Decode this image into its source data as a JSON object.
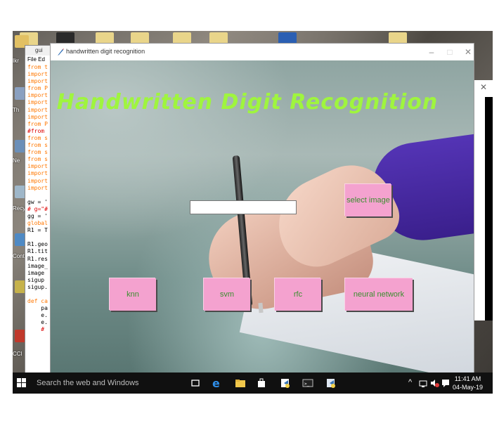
{
  "app_window": {
    "title": "handwritten digit recognition",
    "heading": "Handwritten Digit Recognition",
    "path_input_value": "",
    "buttons": {
      "select_image": "select image",
      "knn": "knn",
      "svm": "svm",
      "rfc": "rfc",
      "neural_network": "neural network"
    },
    "controls": {
      "minimize": "–",
      "maximize": "□",
      "close": "✕"
    },
    "colors": {
      "heading": "#9ff53e",
      "button_bg": "#f4a2cf",
      "button_text": "#3a8f2f"
    }
  },
  "editor_window": {
    "title": "gui",
    "menu": "File  Ed",
    "code_lines": [
      {
        "text": "from t",
        "style": "kw"
      },
      {
        "text": "import",
        "style": "kw"
      },
      {
        "text": "import",
        "style": "kw"
      },
      {
        "text": "from P",
        "style": "kw"
      },
      {
        "text": "import",
        "style": "kw"
      },
      {
        "text": "import",
        "style": "kw"
      },
      {
        "text": "import",
        "style": "kw"
      },
      {
        "text": "import",
        "style": "kw"
      },
      {
        "text": "from P",
        "style": "kw"
      },
      {
        "text": "#from ",
        "style": "cm"
      },
      {
        "text": "from s",
        "style": "kw"
      },
      {
        "text": "from s",
        "style": "kw"
      },
      {
        "text": "from s",
        "style": "kw"
      },
      {
        "text": "from s",
        "style": "kw"
      },
      {
        "text": "import",
        "style": "kw"
      },
      {
        "text": "import",
        "style": "kw"
      },
      {
        "text": "import",
        "style": "kw"
      },
      {
        "text": "import",
        "style": "kw"
      },
      {
        "text": "",
        "style": "pl"
      },
      {
        "text": "gw = '",
        "style": "pl"
      },
      {
        "text": "# g=\"#",
        "style": "cm"
      },
      {
        "text": "gg = '",
        "style": "pl"
      },
      {
        "text": "global",
        "style": "kw"
      },
      {
        "text": "R1 = T",
        "style": "pl"
      },
      {
        "text": "",
        "style": "pl"
      },
      {
        "text": "R1.geo",
        "style": "pl"
      },
      {
        "text": "R1.tit",
        "style": "pl"
      },
      {
        "text": "R1.res",
        "style": "pl"
      },
      {
        "text": "image_",
        "style": "pl"
      },
      {
        "text": "image ",
        "style": "pl"
      },
      {
        "text": "sigup ",
        "style": "pl"
      },
      {
        "text": "sigup.",
        "style": "pl"
      },
      {
        "text": "",
        "style": "pl"
      },
      {
        "text": "def ca",
        "style": "kw"
      },
      {
        "text": "    pa",
        "style": "pl"
      },
      {
        "text": "    e.",
        "style": "pl"
      },
      {
        "text": "    e.",
        "style": "pl"
      },
      {
        "text": "    # ",
        "style": "cm"
      }
    ]
  },
  "desktop": {
    "icon_labels": [
      "Ikr",
      "Th",
      "Ne",
      "Recy",
      "Contr",
      "CCl"
    ]
  },
  "taskbar": {
    "search_placeholder": "Search the web and Windows",
    "tray_chevron": "^",
    "time": "11:41 AM",
    "date": "04-May-19"
  }
}
